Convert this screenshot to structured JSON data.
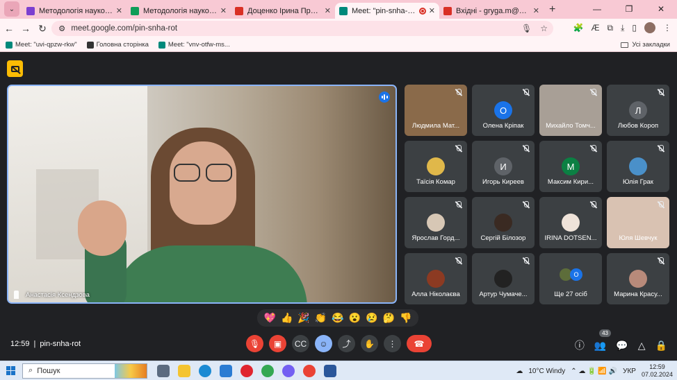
{
  "browser": {
    "tabs": [
      {
        "title": "Методологія наукових досліджень",
        "color": "#7b3fd0",
        "active": false
      },
      {
        "title": "Методологія наукових досліджень",
        "color": "#0f9d58",
        "active": false
      },
      {
        "title": "Доценко Ірина Презентація",
        "color": "#d93025",
        "active": false
      },
      {
        "title": "Meet: \"pin-snha-rot\"",
        "color": "#00897b",
        "active": true
      },
      {
        "title": "Вхідні - gryga.m@academia.vn",
        "color": "#d93025",
        "active": false
      }
    ],
    "url": "meet.google.com/pin-snha-rot",
    "bookmarks": [
      {
        "label": "Meet: \"uvi-qpzw-rkw\"",
        "color": "#00897b"
      },
      {
        "label": "Головна сторінка",
        "color": "#333333"
      },
      {
        "label": "Meet: \"vnv-otfw-ms...",
        "color": "#00897b"
      }
    ],
    "bookmarks_all": "Усі закладки"
  },
  "meet": {
    "main_speaker": "Анастасія Ксендзова",
    "participants": [
      {
        "name": "Людмила Мат...",
        "type": "video",
        "color": "#8a6a4a"
      },
      {
        "name": "Олена Кріпак",
        "type": "initial",
        "initial": "О",
        "color": "#1a73e8"
      },
      {
        "name": "Михайло Томч...",
        "type": "video",
        "color": "#a89f96"
      },
      {
        "name": "Любов Короп",
        "type": "initial",
        "initial": "Л",
        "color": "#5f6368"
      },
      {
        "name": "Таїсія Комар",
        "type": "photo",
        "color": "#e0b84a"
      },
      {
        "name": "Игорь Киреев",
        "type": "initial",
        "initial": "И",
        "color": "#5f6368"
      },
      {
        "name": "Максим Кири...",
        "type": "initial",
        "initial": "М",
        "color": "#0b8043"
      },
      {
        "name": "Юлія Грак",
        "type": "photo",
        "color": "#4a90c9"
      },
      {
        "name": "Ярослав Горд...",
        "type": "photo",
        "color": "#d7c7b5"
      },
      {
        "name": "Сергій Білозор",
        "type": "photo",
        "color": "#3a2a22"
      },
      {
        "name": "IRINA DOTSEN...",
        "type": "photo",
        "color": "#efe3d9"
      },
      {
        "name": "Юля Шевчук",
        "type": "video",
        "color": "#d9c2b2"
      },
      {
        "name": "Алла Ніколаєва",
        "type": "photo",
        "color": "#8c3a22"
      },
      {
        "name": "Артур Чумаче...",
        "type": "photo",
        "color": "#222222"
      },
      {
        "name": "Ще 27 осіб",
        "type": "more",
        "initial": "O",
        "color": "#1a73e8"
      },
      {
        "name": "Марина Красу...",
        "type": "photo",
        "color": "#b88a7a"
      }
    ],
    "reactions": [
      "💖",
      "👍",
      "🎉",
      "👏",
      "😂",
      "😮",
      "😢",
      "🤔",
      "👎"
    ],
    "time": "12:59",
    "meeting_code": "pin-snha-rot",
    "people_count": "43"
  },
  "taskbar": {
    "search_placeholder": "Пошук",
    "weather": "10°C  Windy",
    "lang": "УКР",
    "clock_time": "12:59",
    "clock_date": "07.02.2024"
  }
}
